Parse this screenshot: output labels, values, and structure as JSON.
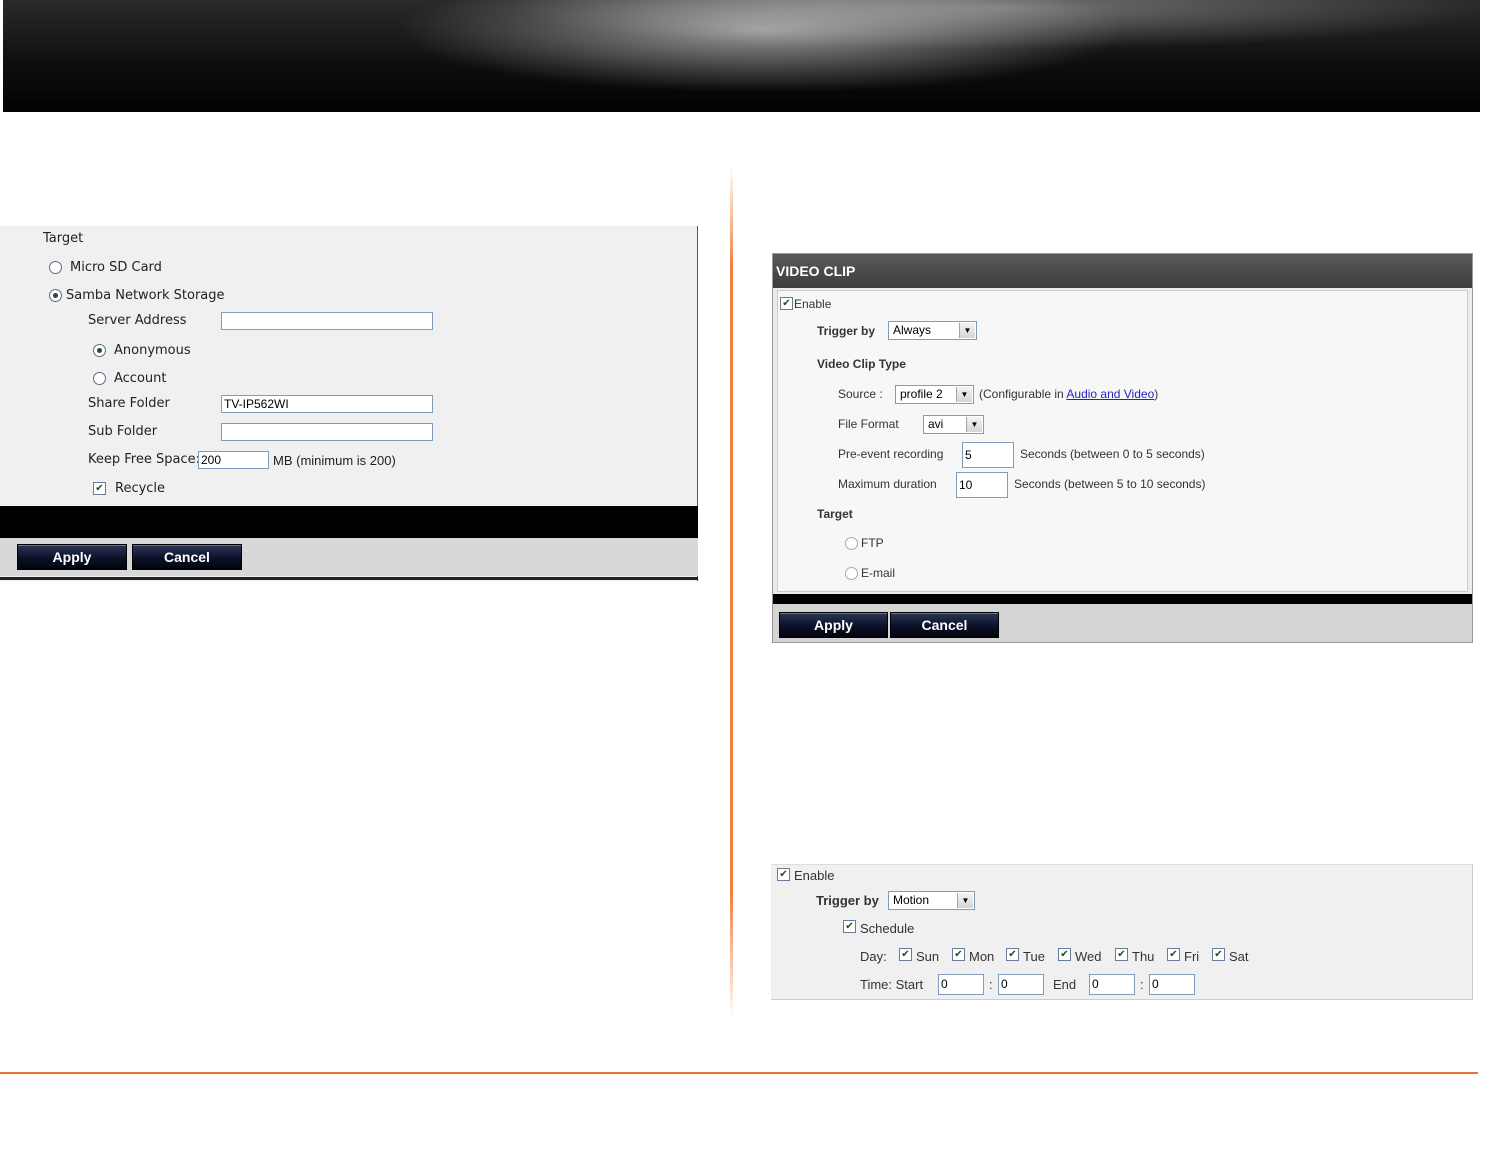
{
  "left_panel": {
    "target_label": "Target",
    "micro_sd_label": "Micro SD Card",
    "samba_label": "Samba Network Storage",
    "server_address_label": "Server Address",
    "server_address_value": "",
    "anonymous_label": "Anonymous",
    "account_label": "Account",
    "share_folder_label": "Share Folder",
    "share_folder_value": "TV-IP562WI",
    "sub_folder_label": "Sub Folder",
    "sub_folder_value": "",
    "keep_free_label": "Keep Free Space:",
    "keep_free_value": "200",
    "keep_free_unit": "MB (minimum is 200)",
    "recycle_label": "Recycle",
    "apply_label": "Apply",
    "cancel_label": "Cancel"
  },
  "video_clip": {
    "title": "VIDEO CLIP",
    "enable_label": "Enable",
    "trigger_label": "Trigger by",
    "trigger_value": "Always",
    "clip_type_label": "Video Clip Type",
    "source_label": "Source :",
    "source_value": "profile 2",
    "source_note_prefix": "(Configurable in ",
    "source_link": "Audio and Video",
    "source_note_suffix": ")",
    "file_format_label": "File Format",
    "file_format_value": "avi",
    "pre_event_label": "Pre-event recording",
    "pre_event_value": "5",
    "pre_event_note": "Seconds  (between 0 to 5 seconds)",
    "max_duration_label": "Maximum duration",
    "max_duration_value": "10",
    "max_duration_note": "Seconds  (between 5 to 10 seconds)",
    "target_label": "Target",
    "ftp_label": "FTP",
    "email_label": "E-mail",
    "apply_label": "Apply",
    "cancel_label": "Cancel"
  },
  "motion": {
    "enable_label": "Enable",
    "trigger_label": "Trigger by",
    "trigger_value": "Motion",
    "schedule_label": "Schedule",
    "day_label": "Day:",
    "days": [
      "Sun",
      "Mon",
      "Tue",
      "Wed",
      "Thu",
      "Fri",
      "Sat"
    ],
    "time_start_label": "Time: Start",
    "start_h": "0",
    "start_m": "0",
    "end_label": "End",
    "end_h": "0",
    "end_m": "0",
    "colon": ":"
  }
}
